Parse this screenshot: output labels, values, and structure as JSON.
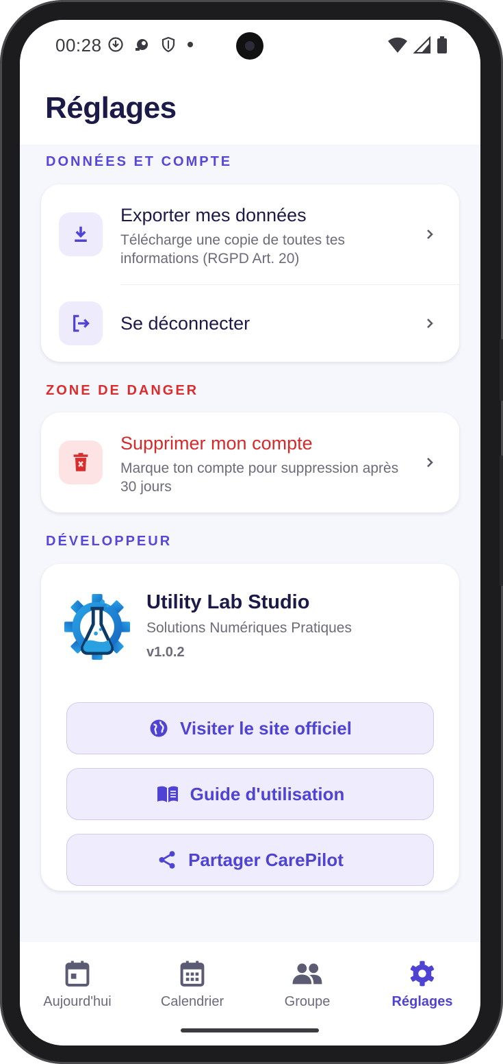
{
  "status_bar": {
    "time": "00:28"
  },
  "header": {
    "title": "Réglages"
  },
  "sections": {
    "account": {
      "label": "DONNÉES ET COMPTE",
      "export": {
        "title": "Exporter mes données",
        "subtitle": "Télécharge une copie de toutes tes informations (RGPD Art. 20)"
      },
      "logout": {
        "title": "Se déconnecter"
      }
    },
    "danger": {
      "label": "ZONE DE DANGER",
      "delete": {
        "title": "Supprimer mon compte",
        "subtitle": "Marque ton compte pour suppression après 30 jours"
      }
    },
    "developer": {
      "label": "DÉVELOPPEUR",
      "name": "Utility Lab Studio",
      "tagline": "Solutions Numériques Pratiques",
      "version": "v1.0.2",
      "buttons": {
        "website": "Visiter le site officiel",
        "guide": "Guide d'utilisation",
        "share": "Partager CarePilot"
      }
    }
  },
  "bottom_nav": {
    "items": [
      {
        "label": "Aujourd'hui",
        "icon": "calendar-today-icon"
      },
      {
        "label": "Calendrier",
        "icon": "calendar-month-icon"
      },
      {
        "label": "Groupe",
        "icon": "group-icon"
      },
      {
        "label": "Réglages",
        "icon": "gear-icon",
        "active": true
      }
    ]
  },
  "colors": {
    "accent": "#4f43d4",
    "danger": "#d92c2c",
    "title": "#1c1a48",
    "background": "#f6f7fc"
  }
}
